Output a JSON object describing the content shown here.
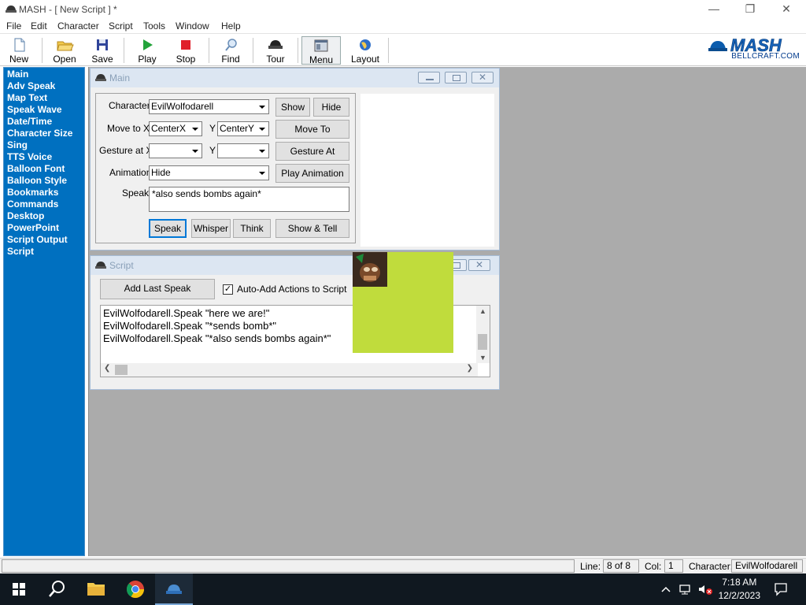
{
  "window": {
    "title": "MASH - [ New Script ] *"
  },
  "menu": [
    "File",
    "Edit",
    "Character",
    "Script",
    "Tools",
    "Window",
    "Help"
  ],
  "toolbar": {
    "new": "New",
    "open": "Open",
    "save": "Save",
    "play": "Play",
    "stop": "Stop",
    "find": "Find",
    "tour": "Tour",
    "menu": "Menu",
    "layout": "Layout"
  },
  "brand": {
    "logo_text": "MASH",
    "sub": "BELLCRAFT.COM"
  },
  "sidebar": {
    "items": [
      "Main",
      "Adv Speak",
      "Map Text",
      "Speak Wave",
      "Date/Time",
      "Character Size",
      "Sing",
      "TTS Voice",
      "Balloon Font",
      "Balloon Style",
      "Bookmarks",
      "Commands",
      "Desktop",
      "PowerPoint",
      "Script Output",
      "Script"
    ]
  },
  "main_window": {
    "title": "Main",
    "character_label": "Character",
    "character_value": "EvilWolfodarell",
    "show_label": "Show",
    "hide_label": "Hide",
    "move_to_label": "Move to X",
    "move_x_value": "CenterX",
    "y_label": "Y",
    "move_y_value": "CenterY",
    "move_to_button": "Move To",
    "gesture_label": "Gesture at X",
    "gesture_x_value": "",
    "gesture_y_value": "",
    "gesture_button": "Gesture At",
    "animation_label": "Animation",
    "animation_value": "Hide",
    "play_animation_button": "Play Animation",
    "speak_label": "Speak",
    "speak_text": "*also sends bombs again*",
    "speak_button": "Speak",
    "whisper_button": "Whisper",
    "think_button": "Think",
    "show_tell_button": "Show & Tell"
  },
  "script_window": {
    "title": "Script",
    "add_last_speak": "Add Last Speak",
    "auto_add_label": "Auto-Add Actions to Script",
    "auto_add_checked": "✓",
    "lines": [
      "EvilWolfodarell.Speak \"here we are!\"",
      "EvilWolfodarell.Speak \"*sends bomb*\"",
      "EvilWolfodarell.Speak \"*also sends bombs again*\""
    ]
  },
  "statusbar": {
    "line_label": "Line:",
    "line_value": "8 of 8",
    "col_label": "Col:",
    "col_value": "1",
    "character_label": "Character:",
    "character_value": "EvilWolfodarell"
  },
  "taskbar": {
    "time": "7:18 AM",
    "date": "12/2/2023"
  },
  "colors": {
    "sidebar": "#0070c0",
    "workspace": "#ababab",
    "character_bg": "#c0dc3c"
  }
}
